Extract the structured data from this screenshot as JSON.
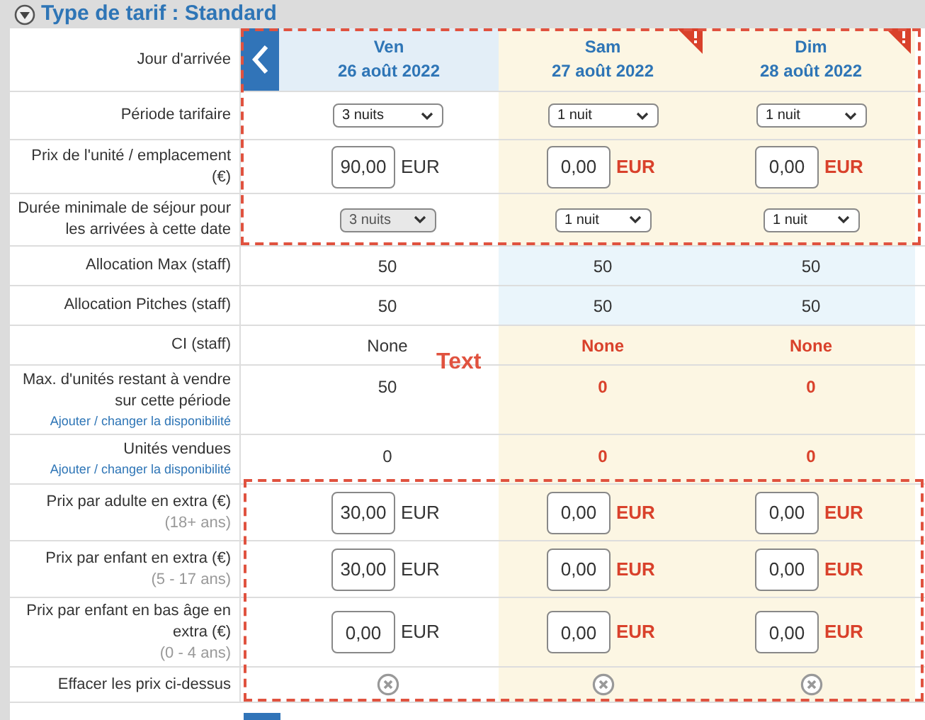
{
  "section": {
    "title": "Type de tarif : Standard",
    "expanded": true
  },
  "annotation_label": "Text",
  "days": [
    {
      "weekday": "Ven",
      "date": "26 août 2022",
      "warning": false
    },
    {
      "weekday": "Sam",
      "date": "27 août 2022",
      "warning": true
    },
    {
      "weekday": "Dim",
      "date": "28 août 2022",
      "warning": true
    }
  ],
  "rows": [
    {
      "kind": "header",
      "label": "Jour d'arrivée"
    },
    {
      "kind": "select",
      "label": "Période tarifaire",
      "compact": false,
      "cells": [
        {
          "value": "3 nuits",
          "disabled": false
        },
        {
          "value": "1 nuit",
          "disabled": false
        },
        {
          "value": "1 nuit",
          "disabled": false
        }
      ]
    },
    {
      "kind": "price",
      "label": "Prix de l'unité / emplacement (€)",
      "cells": [
        {
          "value": "90,00",
          "unit": "EUR"
        },
        {
          "value": "0,00",
          "unit": "EUR"
        },
        {
          "value": "0,00",
          "unit": "EUR"
        }
      ]
    },
    {
      "kind": "select",
      "label": "Durée minimale de séjour pour les arrivées à cette date",
      "compact": true,
      "cells": [
        {
          "value": "3 nuits",
          "disabled": true
        },
        {
          "value": "1 nuit",
          "disabled": false
        },
        {
          "value": "1 nuit",
          "disabled": false
        }
      ]
    },
    {
      "kind": "number",
      "label": "Allocation Max (staff)",
      "flagged": false,
      "cells": [
        "50",
        "50",
        "50"
      ]
    },
    {
      "kind": "number",
      "label": "Allocation Pitches (staff)",
      "flagged": false,
      "cells": [
        "50",
        "50",
        "50"
      ]
    },
    {
      "kind": "number",
      "label": "CI (staff)",
      "flagged": true,
      "cells": [
        "None",
        "None",
        "None"
      ]
    },
    {
      "kind": "number",
      "label": "Max. d'unités restant à vendre sur cette période",
      "link": "Ajouter / changer la disponibilité",
      "flagged": true,
      "cells": [
        "50",
        "0",
        "0"
      ]
    },
    {
      "kind": "number",
      "label": "Unités vendues",
      "link": "Ajouter / changer la disponibilité",
      "flagged": true,
      "cells": [
        "0",
        "0",
        "0"
      ]
    },
    {
      "kind": "price",
      "label": "Prix par adulte en extra (€)",
      "note": "(18+ ans)",
      "cells": [
        {
          "value": "30,00",
          "unit": "EUR"
        },
        {
          "value": "0,00",
          "unit": "EUR"
        },
        {
          "value": "0,00",
          "unit": "EUR"
        }
      ]
    },
    {
      "kind": "price",
      "label": "Prix par enfant en extra (€)",
      "note": "(5 - 17 ans)",
      "cells": [
        {
          "value": "30,00",
          "unit": "EUR"
        },
        {
          "value": "0,00",
          "unit": "EUR"
        },
        {
          "value": "0,00",
          "unit": "EUR"
        }
      ]
    },
    {
      "kind": "price",
      "label": "Prix par enfant en bas âge en extra (€)",
      "note": "(0 - 4 ans)",
      "cells": [
        {
          "value": "0,00",
          "unit": "EUR"
        },
        {
          "value": "0,00",
          "unit": "EUR"
        },
        {
          "value": "0,00",
          "unit": "EUR"
        }
      ]
    },
    {
      "kind": "clear",
      "label": "Effacer les prix ci-dessus"
    }
  ]
}
